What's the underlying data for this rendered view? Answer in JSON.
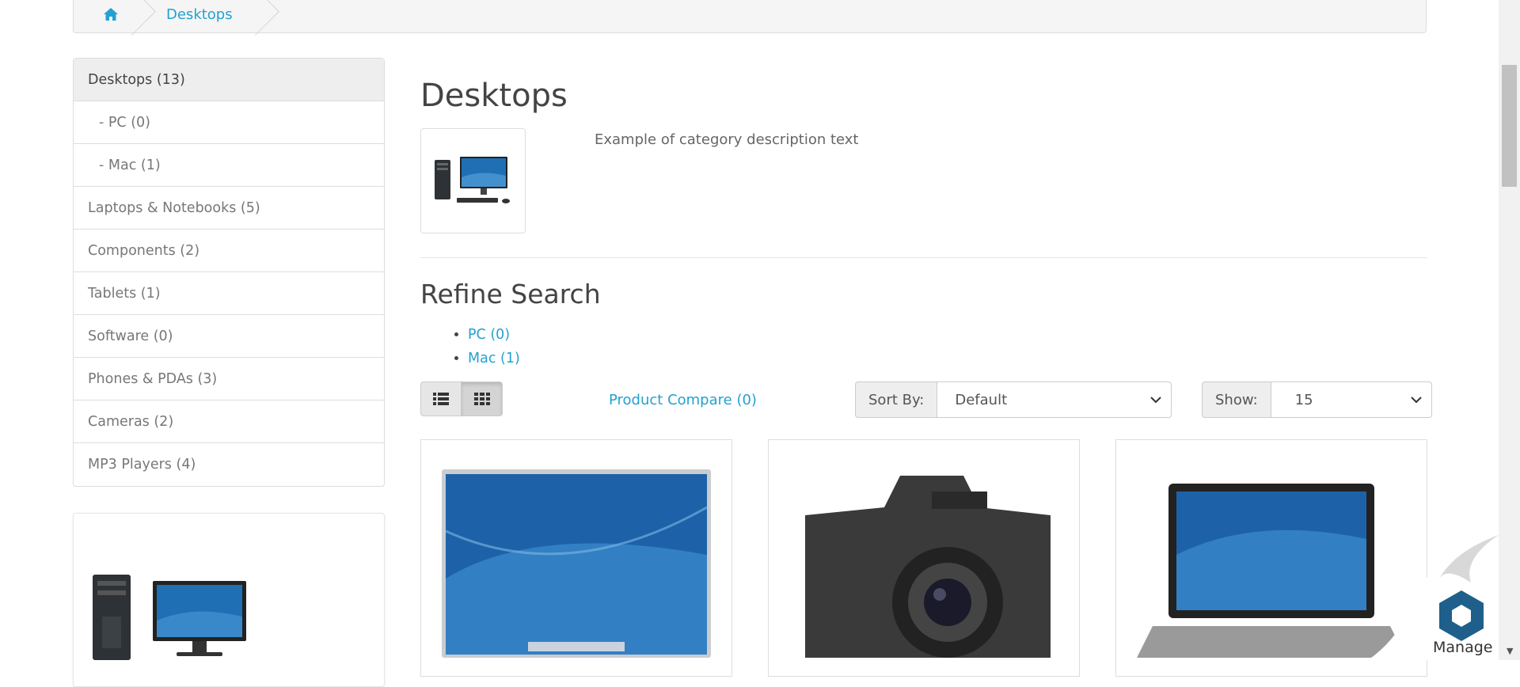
{
  "breadcrumb": {
    "home_icon": "home-icon",
    "items": [
      "Desktops"
    ]
  },
  "sidebar": {
    "categories": [
      {
        "label": "Desktops (13)",
        "active": true,
        "sub": false
      },
      {
        "label": "- PC (0)",
        "active": false,
        "sub": true
      },
      {
        "label": "- Mac (1)",
        "active": false,
        "sub": true
      },
      {
        "label": "Laptops & Notebooks (5)",
        "active": false,
        "sub": false
      },
      {
        "label": "Components (2)",
        "active": false,
        "sub": false
      },
      {
        "label": "Tablets (1)",
        "active": false,
        "sub": false
      },
      {
        "label": "Software (0)",
        "active": false,
        "sub": false
      },
      {
        "label": "Phones & PDAs (3)",
        "active": false,
        "sub": false
      },
      {
        "label": "Cameras (2)",
        "active": false,
        "sub": false
      },
      {
        "label": "MP3 Players (4)",
        "active": false,
        "sub": false
      }
    ]
  },
  "main": {
    "title": "Desktops",
    "description": "Example of category description text",
    "refine_title": "Refine Search",
    "refine_links": [
      "PC (0)",
      "Mac (1)"
    ],
    "compare_link": "Product Compare (0)",
    "sort_label": "Sort By:",
    "sort_value": "Default",
    "show_label": "Show:",
    "show_value": "15"
  },
  "products": [
    {
      "image": "monitor-image"
    },
    {
      "image": "camera-image"
    },
    {
      "image": "laptop-image"
    }
  ],
  "widget": {
    "label": "Manage"
  },
  "colors": {
    "link": "#23a1d1",
    "active_bg": "#eeeeee",
    "border": "#dddddd"
  }
}
